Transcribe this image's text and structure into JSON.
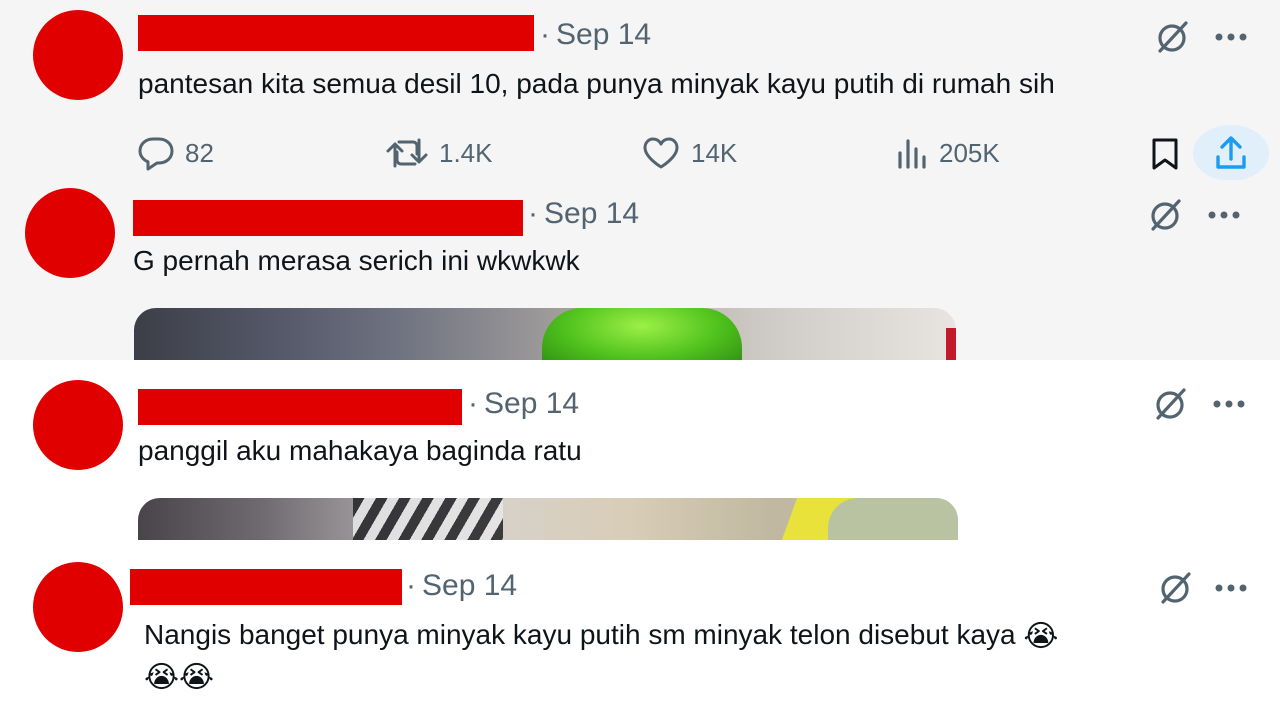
{
  "tweets": [
    {
      "date": "Sep 14",
      "text": "pantesan kita semua desil 10, pada punya minyak kayu putih di rumah sih",
      "stats": {
        "replies": "82",
        "reposts": "1.4K",
        "likes": "14K",
        "views": "205K"
      }
    },
    {
      "date": "Sep 14",
      "text": "G pernah merasa serich ini wkwkwk"
    },
    {
      "date": "Sep 14",
      "text": "panggil aku mahakaya baginda ratu"
    },
    {
      "date": "Sep 14",
      "text_line1": "Nangis banget punya minyak kayu putih sm minyak telon disebut kaya",
      "emoji_inline": "😭",
      "emoji_line2": "😭😭"
    }
  ],
  "separator": "·",
  "icons": {
    "grok": "grok-icon",
    "more": "more-icon",
    "reply": "reply-icon",
    "repost": "repost-icon",
    "like": "like-icon",
    "views": "views-icon",
    "bookmark": "bookmark-icon",
    "share": "share-icon"
  },
  "colors": {
    "redaction": "#e00000",
    "meta_text": "#536471",
    "body_text": "#0f1419",
    "share_accent": "#1d9bf0",
    "share_highlight": "#e1effa"
  }
}
